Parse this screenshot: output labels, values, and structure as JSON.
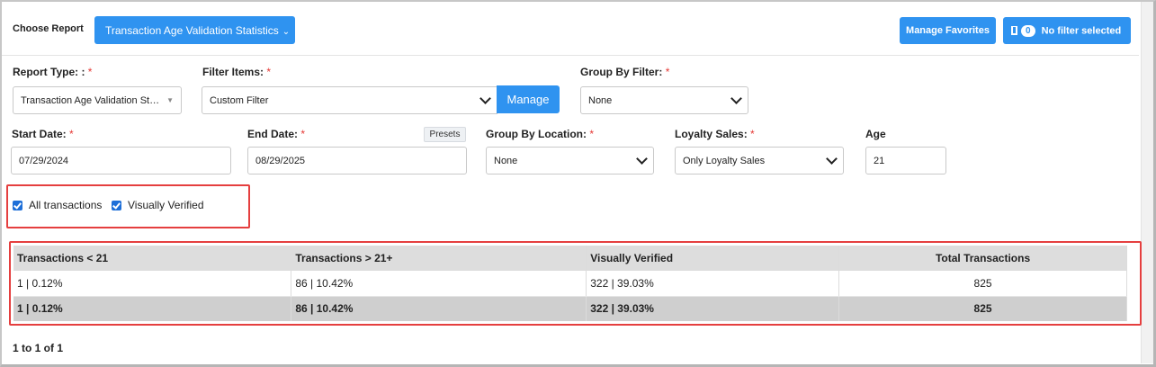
{
  "header": {
    "choose_report_label": "Choose Report",
    "report_dropdown": "Transaction Age Validation Statistics",
    "manage_favorites": "Manage Favorites",
    "filter_count": "0",
    "filter_status": "No filter selected"
  },
  "form": {
    "report_type": {
      "label": "Report Type: :",
      "value": "Transaction Age Validation Stat..."
    },
    "filter_items": {
      "label": "Filter Items:",
      "value": "Custom Filter",
      "button": "Manage"
    },
    "group_by_filter": {
      "label": "Group By Filter:",
      "value": "None"
    },
    "start_date": {
      "label": "Start Date:",
      "value": "07/29/2024"
    },
    "end_date": {
      "label": "End Date:",
      "value": "08/29/2025",
      "presets": "Presets"
    },
    "group_by_location": {
      "label": "Group By Location:",
      "value": "None"
    },
    "loyalty_sales": {
      "label": "Loyalty Sales:",
      "value": "Only Loyalty Sales"
    },
    "age": {
      "label": "Age",
      "value": "21"
    },
    "required_marker": "*"
  },
  "checkboxes": {
    "all_transactions": {
      "label": "All transactions",
      "checked": true
    },
    "visually_verified": {
      "label": "Visually Verified",
      "checked": true
    }
  },
  "table": {
    "columns": [
      "Transactions < 21",
      "Transactions > 21+",
      "Visually Verified",
      "Total Transactions"
    ],
    "rows": [
      [
        "1 | 0.12%",
        "86 | 10.42%",
        "322 | 39.03%",
        "825"
      ]
    ],
    "totals": [
      "1 | 0.12%",
      "86 | 10.42%",
      "322 | 39.03%",
      "825"
    ]
  },
  "pagination": "1 to 1 of 1",
  "colors": {
    "accent": "#2f93f0",
    "highlight": "#e53f3f",
    "required": "#e53935"
  }
}
